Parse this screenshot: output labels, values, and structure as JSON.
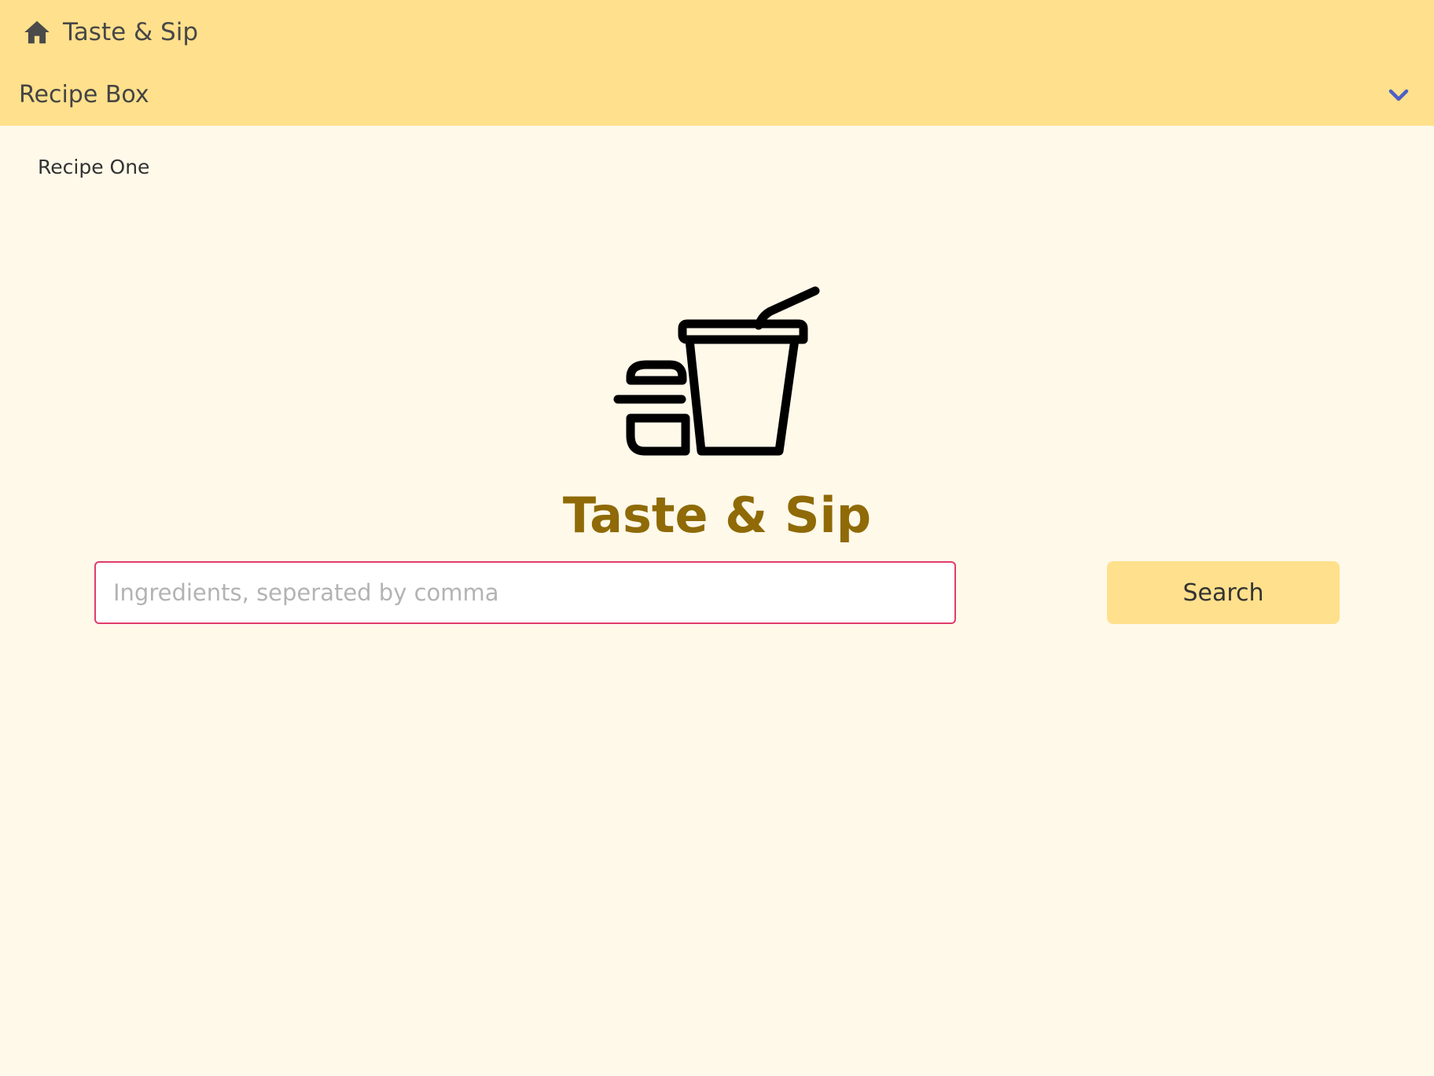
{
  "nav": {
    "brand_label": "Taste & Sip",
    "brand_icon": "home-icon",
    "dropdown_label": "Recipe Box",
    "dropdown_icon": "chevron-down-icon",
    "dropdown_items": [
      "Recipe One"
    ]
  },
  "hero": {
    "logo_icon": "burger-and-drink-icon",
    "title": "Taste & Sip"
  },
  "search": {
    "value": "",
    "placeholder": "Ingredients, seperated by comma",
    "button_label": "Search"
  },
  "colors": {
    "header_bg": "#ffe08c",
    "page_bg": "#fff9ea",
    "title": "#8f6a06",
    "input_border": "#e23c6a",
    "chevron": "#4c5fc8"
  }
}
